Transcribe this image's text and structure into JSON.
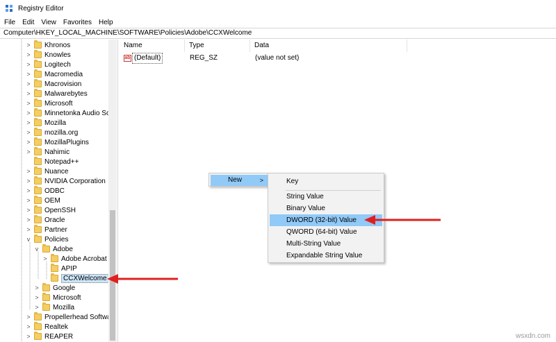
{
  "window": {
    "title": "Registry Editor"
  },
  "menu": [
    "File",
    "Edit",
    "View",
    "Favorites",
    "Help"
  ],
  "address": "Computer\\HKEY_LOCAL_MACHINE\\SOFTWARE\\Policies\\Adobe\\CCXWelcome",
  "tree": {
    "items": [
      {
        "label": "Khronos",
        "chevron": ">"
      },
      {
        "label": "Knowles",
        "chevron": ">"
      },
      {
        "label": "Logitech",
        "chevron": ">"
      },
      {
        "label": "Macromedia",
        "chevron": ">"
      },
      {
        "label": "Macrovision",
        "chevron": ">"
      },
      {
        "label": "Malwarebytes",
        "chevron": ">"
      },
      {
        "label": "Microsoft",
        "chevron": ">"
      },
      {
        "label": "Minnetonka Audio So",
        "chevron": ">"
      },
      {
        "label": "Mozilla",
        "chevron": ">"
      },
      {
        "label": "mozilla.org",
        "chevron": ">"
      },
      {
        "label": "MozillaPlugins",
        "chevron": ">"
      },
      {
        "label": "Nahimic",
        "chevron": ">"
      },
      {
        "label": "Notepad++",
        "chevron": ""
      },
      {
        "label": "Nuance",
        "chevron": ">"
      },
      {
        "label": "NVIDIA Corporation",
        "chevron": ">"
      },
      {
        "label": "ODBC",
        "chevron": ">"
      },
      {
        "label": "OEM",
        "chevron": ">"
      },
      {
        "label": "OpenSSH",
        "chevron": ">"
      },
      {
        "label": "Oracle",
        "chevron": ">"
      },
      {
        "label": "Partner",
        "chevron": ">"
      },
      {
        "label": "Policies",
        "chevron": "v"
      },
      {
        "label": "Adobe",
        "chevron": "v"
      },
      {
        "label": "Adobe Acrobat",
        "chevron": ">"
      },
      {
        "label": "APIP",
        "chevron": ""
      },
      {
        "label": "CCXWelcome",
        "chevron": "",
        "selected": true
      },
      {
        "label": "Google",
        "chevron": ">"
      },
      {
        "label": "Microsoft",
        "chevron": ">"
      },
      {
        "label": "Mozilla",
        "chevron": ">"
      },
      {
        "label": "Propellerhead Softwar",
        "chevron": ">"
      },
      {
        "label": "Realtek",
        "chevron": ">"
      },
      {
        "label": "REAPER",
        "chevron": ">"
      }
    ]
  },
  "values": {
    "columns": [
      "Name",
      "Type",
      "Data"
    ],
    "rows": [
      {
        "icon": "ab",
        "name": "(Default)",
        "type": "REG_SZ",
        "data": "(value not set)"
      }
    ]
  },
  "context_menu": {
    "new_label": "New",
    "new_arrow": ">",
    "submenu": [
      "Key",
      "String Value",
      "Binary Value",
      "DWORD (32-bit) Value",
      "QWORD (64-bit) Value",
      "Multi-String Value",
      "Expandable String Value"
    ],
    "highlighted": "DWORD (32-bit) Value"
  },
  "watermark": "wsxdn.com",
  "colors": {
    "highlight": "#91c9f7",
    "arrow": "#e02020",
    "folder": "#f4cd63"
  },
  "icons": {
    "app": "registry-icon",
    "folder": "folder-icon",
    "value": "string-value-icon"
  }
}
